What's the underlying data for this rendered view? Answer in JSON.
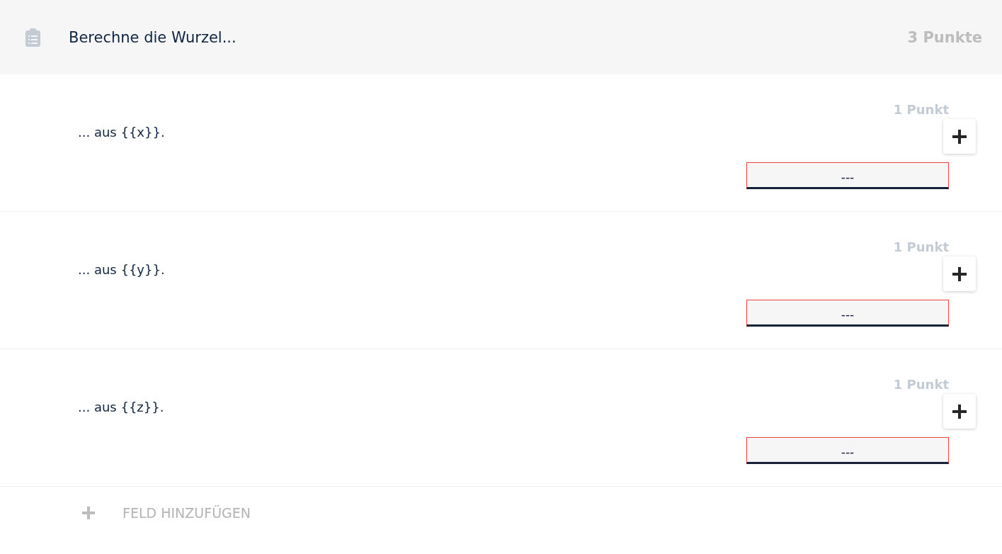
{
  "header": {
    "title": "Berechne die Wurzel...",
    "points": "3 Punkte"
  },
  "items": [
    {
      "text": "... aus {{x}}.",
      "points": "1 Punkt",
      "field_value": "---",
      "invalid": true
    },
    {
      "text": "... aus {{y}}.",
      "points": "1 Punkt",
      "field_value": "---",
      "invalid": true
    },
    {
      "text": "... aus {{z}}.",
      "points": "1 Punkt",
      "field_value": "---",
      "invalid": true
    }
  ],
  "add_field": {
    "label": "FELD HINZUFÜGEN"
  }
}
